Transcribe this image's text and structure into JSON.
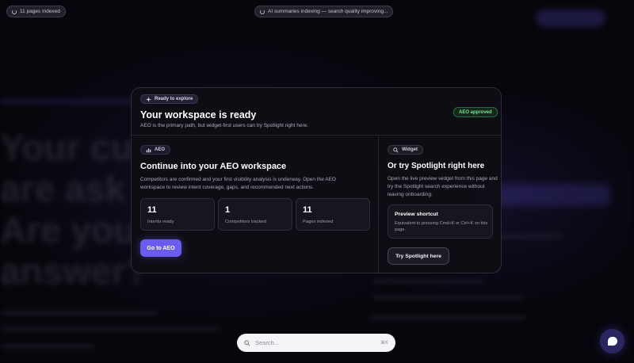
{
  "top_pills": {
    "indexed": "11 pages indexed",
    "summaries": "AI summaries indexing — search quality improving..."
  },
  "modal": {
    "ready_tag": "Ready to explore",
    "title": "Your workspace is ready",
    "subtitle": "AEO is the primary path, but widget-first users can try Spotlight right here.",
    "status_badge": "AEO approved",
    "aeo": {
      "tag": "AEO",
      "title": "Continue into your AEO workspace",
      "body": "Competitors are confirmed and your first visibility analysis is underway. Open the AEO workspace to review intent coverage, gaps, and recommended next actions.",
      "stats": [
        {
          "value": "11",
          "label": "Intents ready"
        },
        {
          "value": "1",
          "label": "Competitors tracked"
        },
        {
          "value": "11",
          "label": "Pages indexed"
        }
      ],
      "button": "Go to AEO"
    },
    "widget": {
      "tag": "Widget",
      "title": "Or try Spotlight right here",
      "body": "Open the live preview widget from this page and try the Spotlight search experience without leaving onboarding.",
      "shortcut_title": "Preview shortcut",
      "shortcut_desc": "Equivalent to pressing Cmd+K or Ctrl+K on this page.",
      "button": "Try Spotlight here"
    }
  },
  "search": {
    "placeholder": "Search...",
    "shortcut": "⌘K"
  },
  "colors": {
    "accent": "#6a5cf0",
    "approved": "#7fe09a",
    "background": "#050409"
  },
  "icons": [
    "spinner-icon",
    "sparkle-icon",
    "chart-icon",
    "search-icon",
    "chat-icon"
  ]
}
